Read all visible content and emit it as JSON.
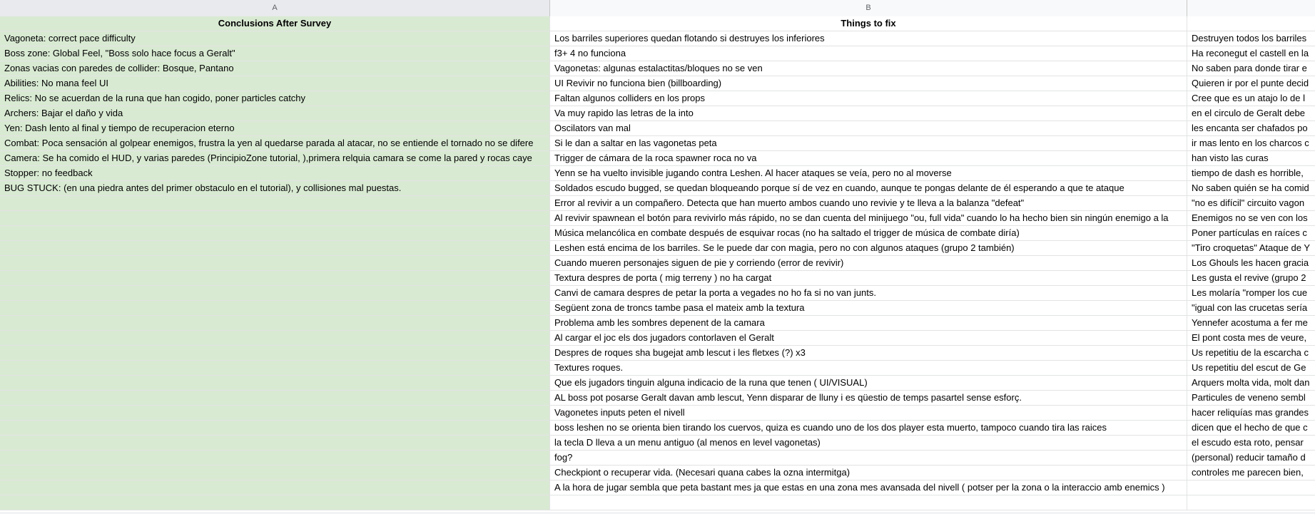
{
  "columns": [
    {
      "letter": "A"
    },
    {
      "letter": "B"
    },
    {
      "letter": ""
    }
  ],
  "header_row": {
    "a": "Conclusions After Survey",
    "b": "Things to fix",
    "c": ""
  },
  "rows": [
    {
      "a": "Vagoneta: correct pace difficulty",
      "b": "Los barriles superiores quedan flotando si destruyes los inferiores",
      "c": "Destruyen todos los barriles"
    },
    {
      "a": "Boss zone: Global Feel, \"Boss solo hace focus a Geralt\"",
      "b": "f3+ 4 no funciona",
      "c": "Ha reconegut el castell en la"
    },
    {
      "a": "Zonas vacias con paredes de collider: Bosque, Pantano",
      "b": "Vagonetas: algunas estalactitas/bloques no se ven",
      "c": "No saben para donde tirar e"
    },
    {
      "a": "Abilities: No mana feel UI",
      "b": "UI Revivir no funciona bien (billboarding)",
      "c": "Quieren ir por el punte decid"
    },
    {
      "a": "Relics: No se acuerdan de la runa que han cogido, poner particles catchy",
      "b": "Faltan algunos colliders en los props",
      "c": "Cree que es un atajo lo de l"
    },
    {
      "a": "Archers: Bajar el daño y vida",
      "b": "Va muy rapido las letras de la into",
      "c": "en el circulo de Geralt debe"
    },
    {
      "a": "Yen: Dash lento al final y tiempo de recuperacion eterno",
      "b": "Oscilators van mal",
      "c": "les encanta ser chafados po"
    },
    {
      "a": "Combat: Poca sensación al golpear enemigos, frustra la yen al quedarse parada al atacar, no se entiende el tornado no se difere",
      "b": "Si le dan a saltar en las vagonetas peta",
      "c": "ir mas lento en los charcos c"
    },
    {
      "a": "Camera: Se ha comido el HUD, y varias paredes (PrincipioZone tutorial, ),primera relquia camara se come la pared y rocas caye",
      "b": "Trigger de cámara de la roca spawner roca no va",
      "c": "han visto las curas"
    },
    {
      "a": "Stopper: no feedback",
      "b": "Yenn se ha vuelto invisible jugando contra Leshen. Al hacer ataques se veía, pero no al moverse",
      "c": "tiempo de dash es horrible,"
    },
    {
      "a": "BUG STUCK: (en una piedra antes del primer obstaculo en el tutorial), y collisiones mal puestas.",
      "b": "Soldados escudo bugged, se quedan bloqueando porque sí de vez en cuando, aunque te pongas delante de él esperando a que te ataque",
      "c": "No saben quién se ha comid"
    },
    {
      "a": "",
      "b": "Error al revivir a un compañero. Detecta que han muerto ambos cuando uno revivie y te lleva a la balanza \"defeat\"",
      "c": "\"no es difícil\" circuito vagon"
    },
    {
      "a": "",
      "b": "Al revivir spawnean el botón para revivirlo más rápido, no se dan cuenta del minijuego \"ou, full vida\" cuando lo ha hecho bien sin ningún enemigo a la",
      "c": "Enemigos no se ven con los"
    },
    {
      "a": "",
      "b": "Música melancólica en combate después de esquivar rocas (no ha saltado el trigger de música de combate diría)",
      "c": "Poner partículas en raíces c"
    },
    {
      "a": "",
      "b": "Leshen está encima de los barriles. Se le puede dar con magia, pero no con algunos ataques (grupo 2 también)",
      "c": "\"Tiro croquetas\" Ataque de Y"
    },
    {
      "a": "",
      "b": "Cuando mueren personajes siguen de pie y corriendo (error de revivir)",
      "c": "Los Ghouls les hacen gracia"
    },
    {
      "a": "",
      "b": "Textura despres de porta ( mig terreny ) no ha cargat",
      "c": "Les gusta el revive (grupo 2"
    },
    {
      "a": "",
      "b": "Canvi de camara despres de petar la porta a vegades no ho fa si no van junts.",
      "c": "Les molaría \"romper los cue"
    },
    {
      "a": "",
      "b": "Següent zona de troncs tambe pasa el mateix amb la textura",
      "c": "\"igual con las crucetas sería"
    },
    {
      "a": "",
      "b": "Problema amb les sombres depenent de la camara",
      "c": "Yennefer acostuma a fer me"
    },
    {
      "a": "",
      "b": "Al cargar el joc els dos jugadors contorlaven el Geralt",
      "c": "El pont costa mes de veure,"
    },
    {
      "a": "",
      "b": "Despres de roques sha bugejat amb lescut i les fletxes (?) x3",
      "c": "Us repetitiu de la escarcha c"
    },
    {
      "a": "",
      "b": "Textures roques.",
      "c": "Us repetitiu del escut de Ge"
    },
    {
      "a": "",
      "b": "Que els jugadors tinguin alguna indicacio de la runa que tenen ( UI/VISUAL)",
      "c": "Arquers molta vida, molt dan"
    },
    {
      "a": "",
      "b": "AL boss pot posarse Geralt davan amb lescut, Yenn disparar de lluny i es qüestio de temps pasartel sense esforç.",
      "c": "Particules de veneno sembl"
    },
    {
      "a": "",
      "b": "Vagonetes inputs peten el nivell",
      "c": "hacer reliquías mas grandes"
    },
    {
      "a": "",
      "b": "boss leshen no se orienta bien tirando los cuervos, quiza es cuando uno de los dos player esta muerto, tampoco cuando tira las raices",
      "c": "dicen que el hecho de que c"
    },
    {
      "a": "",
      "b": "la tecla D lleva a un menu antiguo (al menos en level vagonetas)",
      "c": "el escudo esta roto, pensar"
    },
    {
      "a": "",
      "b": "fog?",
      "c": "(personal) reducir tamaño d"
    },
    {
      "a": "",
      "b": "Checkpiont o recuperar vida. (Necesari quana cabes la ozna intermitga)",
      "c": "controles me parecen bien,"
    },
    {
      "a": "",
      "b": "A la hora de jugar sembla que peta bastant mes ja que estas en una zona mes avansada del nivell ( potser per la zona o la interaccio amb enemics )",
      "c": ""
    },
    {
      "a": "",
      "b": "",
      "c": ""
    }
  ]
}
